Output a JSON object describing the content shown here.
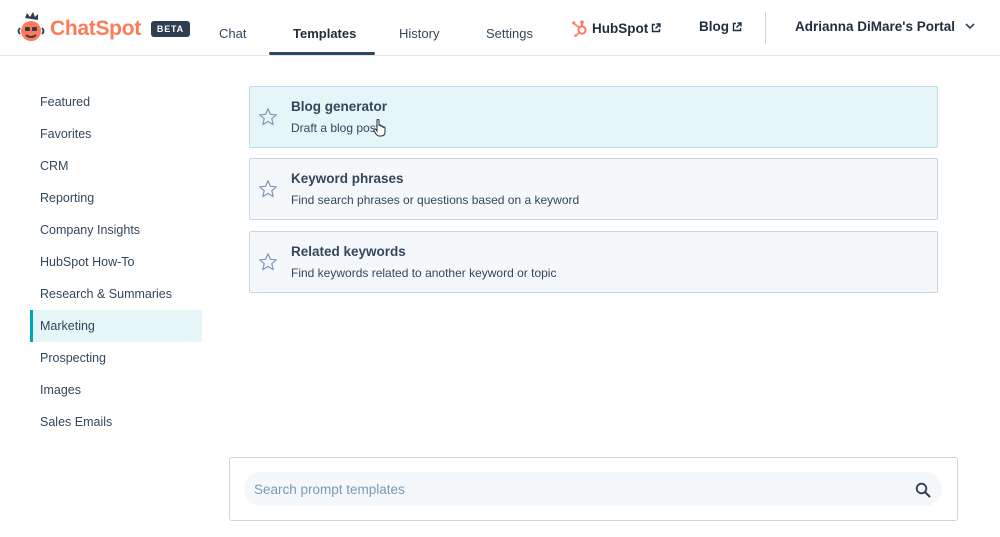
{
  "app": {
    "brand": "ChatSpot",
    "badge": "BETA"
  },
  "nav": {
    "tabs": [
      {
        "label": "Chat"
      },
      {
        "label": "Templates",
        "active": true
      },
      {
        "label": "History"
      },
      {
        "label": "Settings"
      }
    ],
    "links": [
      {
        "label": "HubSpot",
        "icon": "hubspot-sprocket-icon"
      },
      {
        "label": "Blog"
      }
    ],
    "portal": "Adrianna DiMare's Portal"
  },
  "sidebar": {
    "items": [
      {
        "label": "Featured"
      },
      {
        "label": "Favorites"
      },
      {
        "label": "CRM"
      },
      {
        "label": "Reporting"
      },
      {
        "label": "Company Insights"
      },
      {
        "label": "HubSpot How-To"
      },
      {
        "label": "Research & Summaries"
      },
      {
        "label": "Marketing",
        "active": true
      },
      {
        "label": "Prospecting"
      },
      {
        "label": "Images"
      },
      {
        "label": "Sales Emails"
      }
    ]
  },
  "templates": [
    {
      "title": "Blog generator",
      "description": "Draft a blog post",
      "hovered": true
    },
    {
      "title": "Keyword phrases",
      "description": "Find search phrases or questions based on a keyword"
    },
    {
      "title": "Related keywords",
      "description": "Find keywords related to another keyword or topic"
    }
  ],
  "search": {
    "placeholder": "Search prompt templates",
    "value": ""
  },
  "colors": {
    "brand": "#ff7a59",
    "text": "#33475b",
    "accent": "#00a4bd",
    "active_bg": "#e5f5f8",
    "card_bg": "#f5f8fa"
  }
}
